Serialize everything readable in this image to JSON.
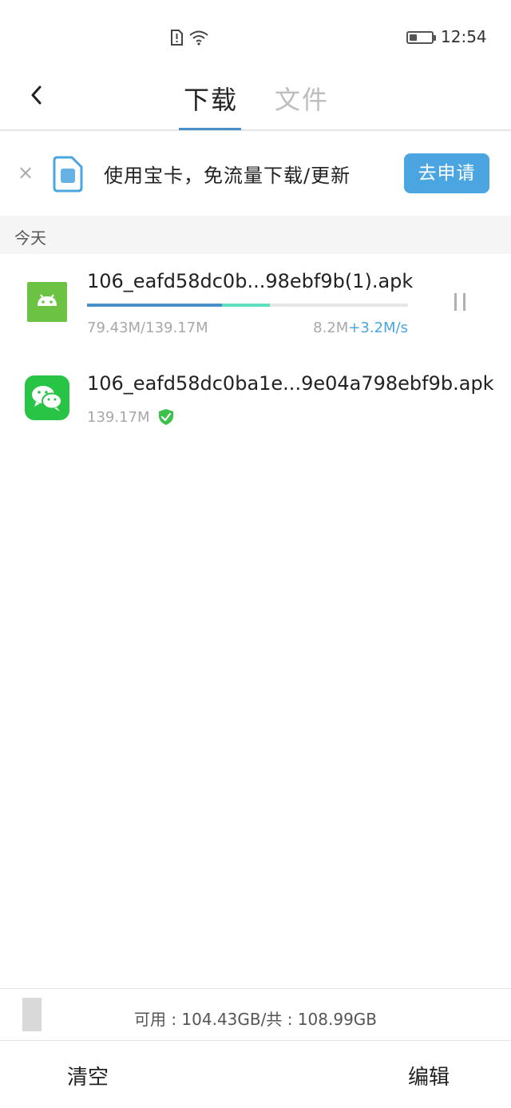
{
  "status_bar": {
    "time": "12:54",
    "battery_level": 0.35,
    "icons": [
      "sim-alert-icon",
      "wifi-icon",
      "battery-icon"
    ]
  },
  "header": {
    "tabs": [
      {
        "label": "下载",
        "active": true
      },
      {
        "label": "文件",
        "active": false
      }
    ]
  },
  "promo": {
    "text": "使用宝卡，免流量下载/更新",
    "button_label": "去申请",
    "close_glyph": "×"
  },
  "section": {
    "label": "今天"
  },
  "downloads": [
    {
      "file_name": "106_eafd58dc0b...98ebf9b(1).apk",
      "progress_text": "79.43M/139.17M",
      "progress_fraction": 0.57,
      "boost_fraction": 0.15,
      "speed": "8.2M",
      "boost_speed": "+3.2M/s",
      "icon": "android-icon",
      "status": "downloading"
    },
    {
      "file_name": "106_eafd58dc0ba1e...9e04a798ebf9b.apk",
      "size_text": "139.17M",
      "icon": "wechat-icon",
      "status": "completed-verified"
    }
  ],
  "storage": {
    "text": "可用 : 104.43GB/共 : 108.99GB"
  },
  "bottom_actions": {
    "clear_label": "清空",
    "edit_label": "编辑"
  },
  "colors": {
    "accent": "#4aa5e0",
    "progress": "#4a90c8",
    "boost": "#5ee0c0",
    "android_green": "#6cc242",
    "wechat_green": "#28c445"
  }
}
